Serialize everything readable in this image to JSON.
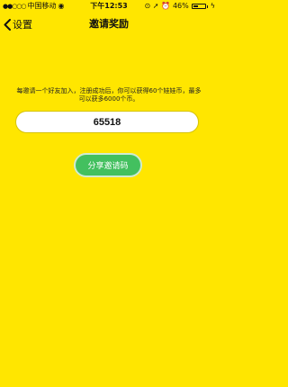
{
  "status_bar": {
    "signal": "●●○○○",
    "carrier": "中国移动",
    "wifi": "◉",
    "time": "下午12:53",
    "icons": "⊙ ➚ ⏰",
    "battery_percent": "46%",
    "battery_level": 0.46,
    "charging": "ϟ"
  },
  "nav": {
    "back_icon": "chevron-left",
    "back_label": "设置",
    "title": "邀请奖励"
  },
  "main": {
    "description": "每邀请一个好友加入，注册成功后，你可以获得60个娃娃币，最多可以获多6000个币。",
    "invite_code": "65518",
    "share_button": "分享邀请码"
  },
  "colors": {
    "background": "#FFE600",
    "button": "#43C05F"
  }
}
